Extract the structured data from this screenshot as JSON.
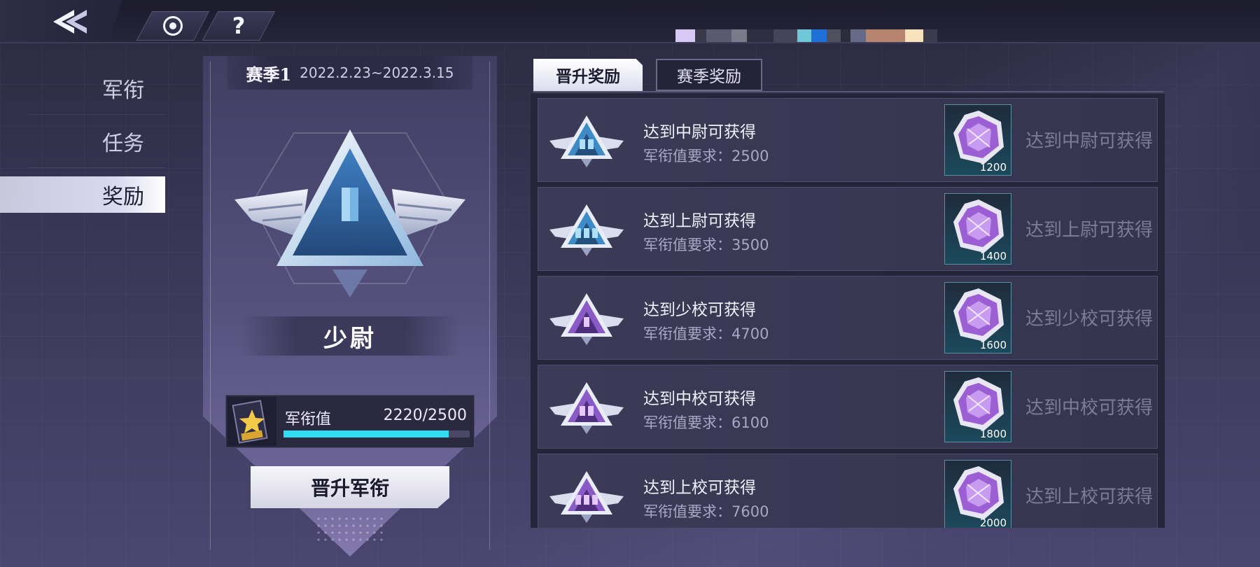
{
  "colors": {
    "accent_cyan": "#2fdcf0",
    "nav_active_bg": "#d8d8ef",
    "claim_text": "#7d7b98",
    "currency_swatches": [
      "#d7c8f4",
      "#3a394c",
      "#5a5970",
      "#7a7a88",
      "#2f2e40",
      "#45445a",
      "#6fc8d8",
      "#1f6fd9",
      "#4f4f5e",
      "#2d2c3d",
      "#666a86",
      "#b7856e",
      "#f6e3bd",
      "#3b3a4e"
    ]
  },
  "topbar": {
    "back_icon": "double-chevron-left-icon",
    "target_icon": "target-icon",
    "help_label": "?"
  },
  "nav": {
    "items": [
      {
        "label": "军衔",
        "active": false
      },
      {
        "label": "任务",
        "active": false
      },
      {
        "label": "奖励",
        "active": true
      }
    ]
  },
  "season": {
    "label": "赛季1",
    "dates": "2022.2.23~2022.3.15"
  },
  "rank": {
    "name": "少尉",
    "emblem_icon": "winged-triangle-rank-icon"
  },
  "progress": {
    "label": "军衔值",
    "value_text": "2220/2500",
    "current": 2220,
    "max": 2500,
    "icon": "rank-medal-card-icon"
  },
  "promote_button": {
    "label": "晋升军衔"
  },
  "tabs": [
    {
      "label": "晋升奖励",
      "active": true
    },
    {
      "label": "赛季奖励",
      "active": false
    }
  ],
  "rewards": [
    {
      "title": "达到中尉可获得",
      "requirement": "军衔值要求：2500",
      "reward_count": "1200",
      "claim_text": "达到中尉可获得",
      "rank_color": "blue",
      "pips": 2
    },
    {
      "title": "达到上尉可获得",
      "requirement": "军衔值要求：3500",
      "reward_count": "1400",
      "claim_text": "达到上尉可获得",
      "rank_color": "blue",
      "pips": 3
    },
    {
      "title": "达到少校可获得",
      "requirement": "军衔值要求：4700",
      "reward_count": "1600",
      "claim_text": "达到少校可获得",
      "rank_color": "purple",
      "pips": 1
    },
    {
      "title": "达到中校可获得",
      "requirement": "军衔值要求：6100",
      "reward_count": "1800",
      "claim_text": "达到中校可获得",
      "rank_color": "purple",
      "pips": 2
    },
    {
      "title": "达到上校可获得",
      "requirement": "军衔值要求：7600",
      "reward_count": "2000",
      "claim_text": "达到上校可获得",
      "rank_color": "purple",
      "pips": 3
    }
  ]
}
